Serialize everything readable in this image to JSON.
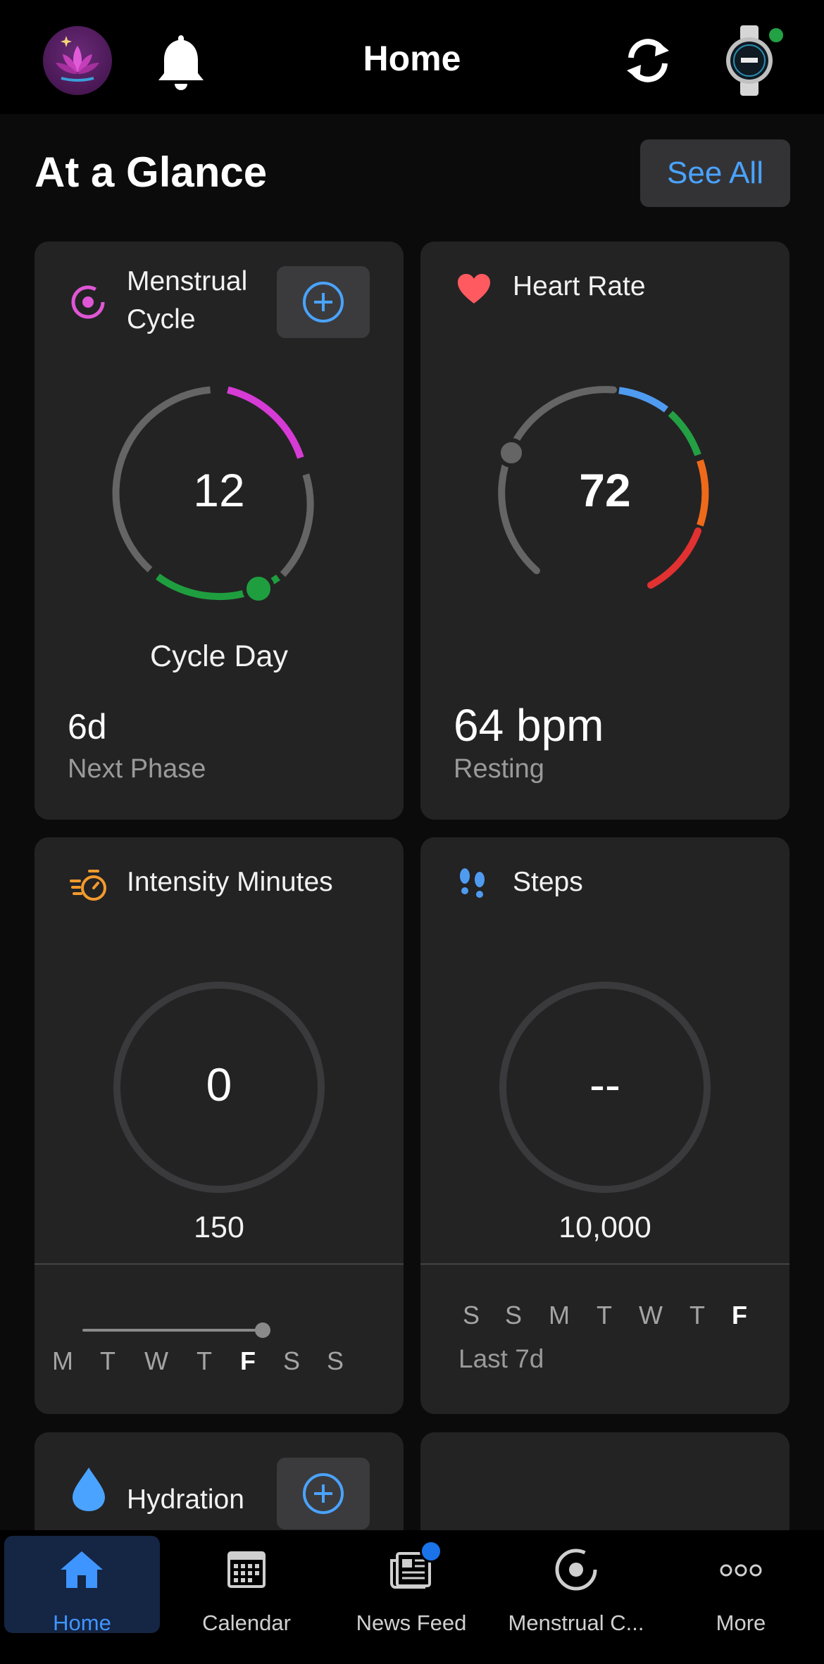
{
  "header": {
    "title": "Home",
    "avatar_icon": "lotus-avatar-icon",
    "bell_icon": "bell-icon",
    "sync_icon": "sync-icon",
    "device_icon": "smartwatch-icon",
    "device_status_color": "#22a245"
  },
  "glance": {
    "title": "At a Glance",
    "see_all": "See All"
  },
  "cards": {
    "menstrual": {
      "title_line1": "Menstrual",
      "title_line2": "Cycle",
      "value": "12",
      "center_label": "Cycle Day",
      "stat": "6d",
      "stat_label": "Next Phase"
    },
    "heart_rate": {
      "title": "Heart Rate",
      "value": "72",
      "stat": "64 bpm",
      "stat_label": "Resting"
    },
    "intensity": {
      "title": "Intensity Minutes",
      "value": "0",
      "goal": "150",
      "days": [
        "M",
        "T",
        "W",
        "T",
        "F",
        "S",
        "S"
      ],
      "active_day_index": 4
    },
    "steps": {
      "title": "Steps",
      "value": "--",
      "goal": "10,000",
      "days": [
        "S",
        "S",
        "M",
        "T",
        "W",
        "T",
        "F"
      ],
      "active_day_index": 6,
      "range_label": "Last 7d"
    },
    "hydration": {
      "title": "Hydration"
    }
  },
  "tabbar": {
    "tabs": [
      {
        "label": "Home",
        "icon": "home-icon",
        "active": true
      },
      {
        "label": "Calendar",
        "icon": "calendar-icon",
        "active": false
      },
      {
        "label": "News Feed",
        "icon": "news-feed-icon",
        "active": false
      },
      {
        "label": "Menstrual C...",
        "icon": "cycle-icon",
        "active": false
      },
      {
        "label": "More",
        "icon": "more-icon",
        "active": false
      }
    ]
  },
  "colors": {
    "accent_blue": "#4aa3ff",
    "cycle_pink": "#d63bd6",
    "cycle_green": "#1f9e3f",
    "hr_blue": "#4f9bf0",
    "hr_green": "#23a043",
    "hr_orange": "#ee6a1a",
    "hr_red": "#e23131",
    "heart_color": "#ff5a5f",
    "intensity_orange": "#f29a2e"
  }
}
